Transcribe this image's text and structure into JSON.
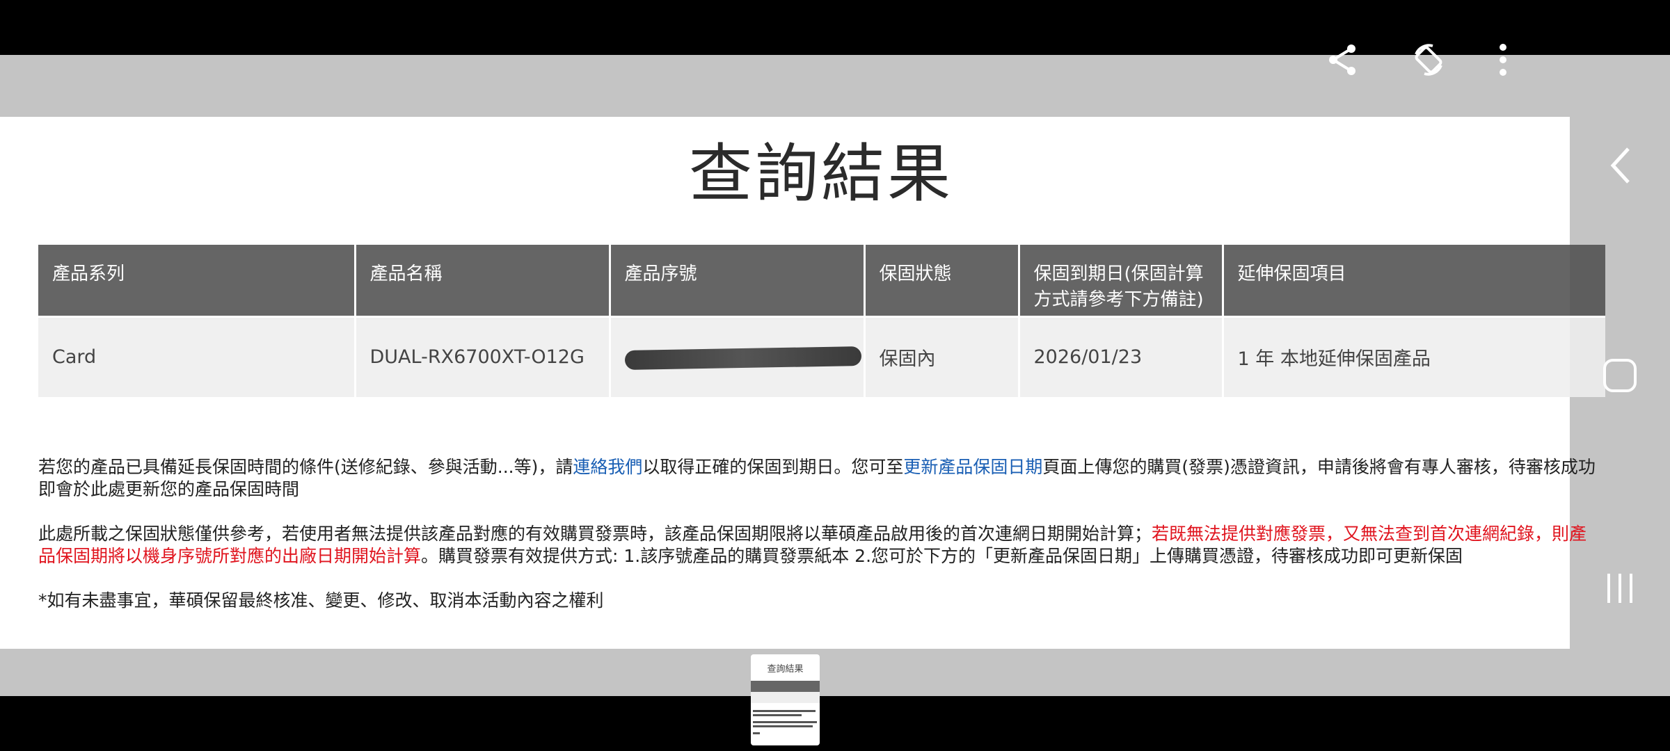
{
  "page": {
    "title": "查詢結果"
  },
  "table": {
    "headers": [
      "產品系列",
      "產品名稱",
      "產品序號",
      "保固狀態",
      "保固到期日(保固計算方式請參考下方備註)",
      "延伸保固項目"
    ],
    "row": {
      "series": "Card",
      "name": "DUAL-RX6700XT-O12G",
      "serial": "",
      "status": "保固內",
      "expiry": "2026/01/23",
      "extended": "1 年 本地延伸保固產品"
    }
  },
  "notes": {
    "p1_a": "若您的產品已具備延長保固時間的條件(送修紀錄、參與活動...等)，請",
    "p1_link1": "連絡我們",
    "p1_b": "以取得正確的保固到期日。您可至",
    "p1_link2": "更新產品保固日期",
    "p1_c": "頁面上傳您的購買(發票)憑證資訊，申請後將會有專人審核，待審核成功即會於此處更新您的產品保固時間",
    "p2_a": "此處所載之保固狀態僅供參考，若使用者無法提供該產品對應的有效購買發票時，該產品保固期限將以華碩產品啟用後的首次連網日期開始計算；",
    "p2_red": "若既無法提供對應發票，又無法查到首次連網紀錄，則產品保固期將以機身序號所對應的出廠日期開始計算",
    "p2_b": "。購買發票有效提供方式: 1.該序號產品的購買發票紙本 2.您可於下方的「更新產品保固日期」上傳購買憑證，待審核成功即可更新保固",
    "p3": "*如有未盡事宜，華碩保留最終核准、變更、修改、取消本活動內容之權利"
  },
  "thumbnail": {
    "title": "查詢結果"
  },
  "icons": {
    "share": "share-icon",
    "rotate": "rotate-icon",
    "more": "more-vert-icon",
    "back": "back-chevron-icon",
    "home": "home-square-icon",
    "recents": "recents-icon"
  },
  "colors": {
    "link": "#1a5fb4",
    "warning": "#e0141e",
    "header_bg": "#505050"
  }
}
